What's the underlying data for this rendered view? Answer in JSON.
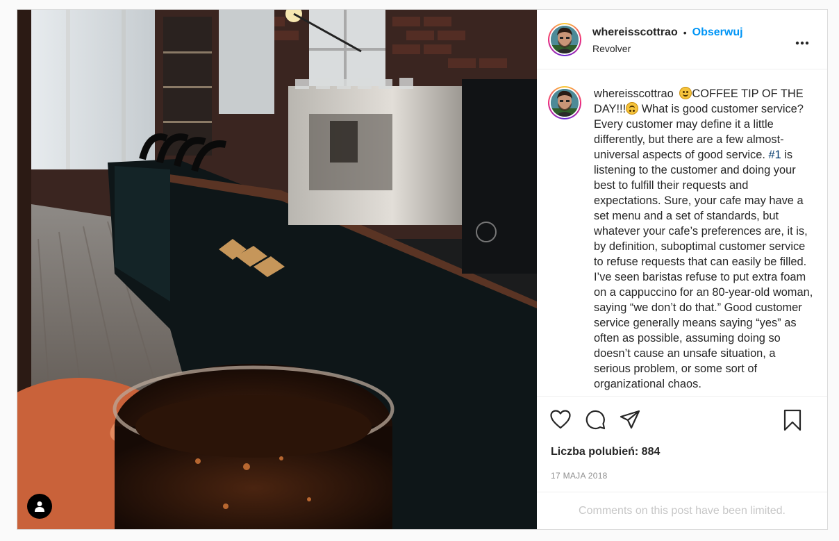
{
  "post": {
    "author": {
      "username": "whereisscottrao",
      "location": "Revolver"
    },
    "follow_label": "Obserwuj",
    "separator": "•",
    "caption": {
      "username": "whereisscottrao",
      "emoji_1": "smiling-face-emoji",
      "part_1": "COFFEE TIP OF THE DAY!!!",
      "emoji_2": "upside-down-face-emoji",
      "part_2": " What is good customer service? Every customer may define it a little differently, but there are a few almost-universal aspects of good service.",
      "hashtag": "#1",
      "part_3": " is listening to the customer and doing your best to fulfill their requests and expectations. Sure, your cafe may have a set menu and a set of standards, but whatever your cafe’s preferences are, it is, by definition, suboptimal customer service to refuse requests that can easily be filled. I’ve seen baristas refuse to put extra foam on a cappuccino for an 80-year-old woman, saying “we don’t do that.” Good customer service generally means saying “yes” as often as possible, assuming doing so doesn’t cause an unsafe situation, a serious problem, or some sort of organizational chaos."
    },
    "likes_text": "Liczba polubień: 884",
    "date_text": "17 MAJA 2018",
    "comments_limited_text": "Comments on this post have been limited.",
    "icons": {
      "more": "more-options-icon",
      "like": "heart-icon",
      "comment": "comment-icon",
      "share": "share-icon",
      "save": "bookmark-icon",
      "tag": "user-tag-icon"
    },
    "colors": {
      "follow": "#0095f6",
      "border": "#dbdbdb",
      "muted": "#8e8e8e",
      "hashtag": "#00376b"
    }
  }
}
